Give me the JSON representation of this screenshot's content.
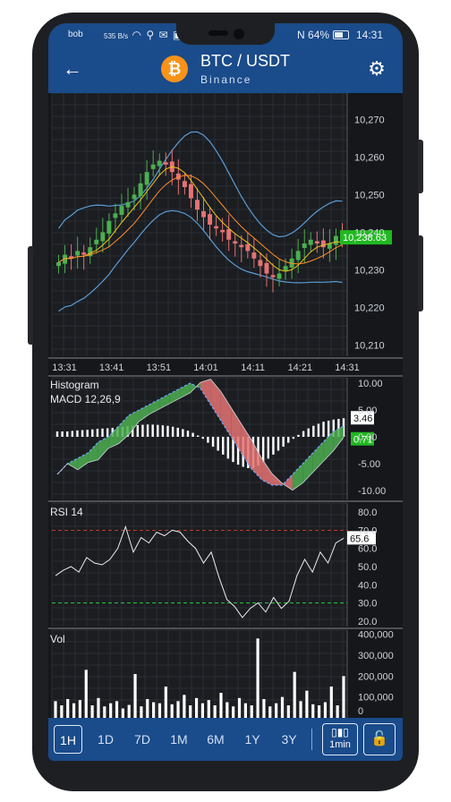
{
  "status_bar": {
    "carrier": "bob",
    "net_speed": "535 B/s",
    "icons": [
      "wifi-icon",
      "usb-icon",
      "mail-icon",
      "message-icon"
    ],
    "nfc": "N",
    "battery": "64%",
    "battery_level": 0.64,
    "time": "14:31"
  },
  "header": {
    "back_icon": "arrow-left-icon",
    "coin_symbol": "₿",
    "title": "BTC / USDT",
    "subtitle": "Binance",
    "settings_icon": "gear-icon"
  },
  "colors": {
    "bar": "#1a4b8a",
    "background": "#15171b",
    "up": "#4caf50",
    "down": "#e57373",
    "price_badge": "#22b822",
    "band": "#5b9bd5",
    "ma_fast": "#f0c419",
    "ma_slow": "#ff8c2a"
  },
  "price_panel": {
    "y_ticks": [
      "10,270",
      "10,260",
      "10,250",
      "10,240",
      "10,230",
      "10,220",
      "10,210"
    ],
    "x_ticks": [
      "13:31",
      "13:41",
      "13:51",
      "14:01",
      "14:11",
      "14:21",
      "14:31"
    ],
    "last_price": "10,238.63"
  },
  "macd_panel": {
    "label1": "Histogram",
    "label2": "MACD 12,26,9",
    "y_ticks": [
      "10.00",
      "5.00",
      "0.00",
      "-5.00",
      "-10.00"
    ],
    "value1": "3.46",
    "value2": "0.71"
  },
  "rsi_panel": {
    "label": "RSI 14",
    "y_ticks": [
      "80.0",
      "70.0",
      "60.0",
      "50.0",
      "40.0",
      "30.0",
      "20.0"
    ],
    "value": "65.6"
  },
  "vol_panel": {
    "label": "Vol",
    "y_ticks": [
      "400,000",
      "300,000",
      "200,000",
      "100,000",
      "0"
    ]
  },
  "toolbar": {
    "timeframes": [
      "1H",
      "1D",
      "7D",
      "1M",
      "6M",
      "1Y",
      "3Y"
    ],
    "selected": "1H",
    "interval_icon": "candlestick-icon",
    "interval_label": "1min",
    "lock_icon": "lock-icon"
  },
  "chart_data": [
    {
      "type": "candlestick",
      "title": "BTC / USDT",
      "x_ticks": [
        "13:31",
        "13:41",
        "13:51",
        "14:01",
        "14:11",
        "14:21",
        "14:31"
      ],
      "ylim": [
        10207,
        10277
      ],
      "y_ticks": [
        10270,
        10260,
        10250,
        10240,
        10230,
        10220,
        10210
      ],
      "close": [
        10232,
        10234,
        10233,
        10235,
        10234,
        10236,
        10238,
        10240,
        10243,
        10245,
        10247,
        10248,
        10250,
        10253,
        10256,
        10258,
        10259,
        10258,
        10256,
        10254,
        10252,
        10249,
        10246,
        10244,
        10242,
        10241,
        10240,
        10238,
        10237,
        10236,
        10235,
        10233,
        10231,
        10229,
        10228,
        10229,
        10231,
        10233,
        10235,
        10237,
        10238,
        10237,
        10236,
        10237,
        10239,
        10238
      ],
      "last_price": 10238.63,
      "overlays": [
        "bollinger upper",
        "bollinger lower",
        "moving average fast",
        "moving average slow"
      ]
    },
    {
      "type": "line",
      "title": "MACD 12,26,9",
      "ylim": [
        -10,
        10
      ],
      "series": [
        {
          "name": "MACD",
          "values": [
            -7,
            -5,
            -4,
            -3,
            -1,
            0,
            2,
            4,
            5,
            6,
            7,
            8,
            9,
            10,
            9,
            6,
            3,
            0,
            -3,
            -6,
            -8,
            -9,
            -9,
            -7,
            -5,
            -3,
            -1,
            1,
            2
          ]
        },
        {
          "name": "Histogram",
          "values": [
            1,
            1,
            1.2,
            1.3,
            1.5,
            1.6,
            1.8,
            2,
            2.2,
            2.3,
            2.2,
            2,
            1.6,
            1,
            0,
            -1.5,
            -3,
            -4.5,
            -5.5,
            -6,
            -5,
            -3.5,
            -2,
            -0.5,
            1,
            2,
            2.8,
            3.2,
            3.46
          ]
        }
      ],
      "current": [
        3.46,
        0.71
      ]
    },
    {
      "type": "line",
      "title": "RSI 14",
      "ylim": [
        17,
        85
      ],
      "y_ticks": [
        80,
        70,
        60,
        50,
        40,
        30,
        20
      ],
      "levels": [
        70,
        30
      ],
      "values": [
        45,
        48,
        50,
        47,
        55,
        52,
        51,
        54,
        60,
        72,
        58,
        66,
        63,
        69,
        67,
        70,
        69,
        64,
        60,
        52,
        58,
        44,
        32,
        28,
        22,
        27,
        30,
        25,
        33,
        27,
        31,
        45,
        54,
        47,
        58,
        52,
        63,
        65.6
      ]
    },
    {
      "type": "bar",
      "title": "Vol",
      "ylim": [
        0,
        420000
      ],
      "y_ticks": [
        400000,
        300000,
        200000,
        100000,
        0
      ],
      "values": [
        80000,
        60000,
        90000,
        70000,
        85000,
        230000,
        60000,
        95000,
        55000,
        70000,
        80000,
        45000,
        62000,
        210000,
        55000,
        90000,
        75000,
        70000,
        150000,
        65000,
        80000,
        110000,
        60000,
        95000,
        70000,
        85000,
        60000,
        120000,
        75000,
        55000,
        95000,
        70000,
        60000,
        380000,
        90000,
        55000,
        70000,
        100000,
        60000,
        220000,
        80000,
        130000,
        65000,
        60000,
        75000,
        150000,
        60000,
        200000
      ]
    }
  ]
}
